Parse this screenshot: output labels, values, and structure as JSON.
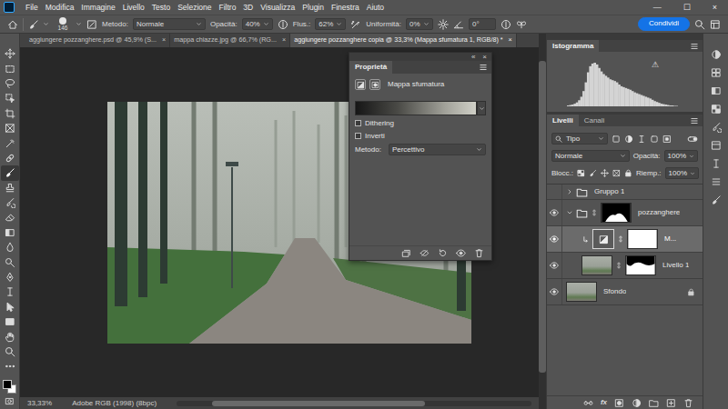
{
  "window": {
    "controls": [
      "—",
      "☐",
      "×"
    ]
  },
  "menu": [
    "File",
    "Modifica",
    "Immagine",
    "Livello",
    "Testo",
    "Selezione",
    "Filtro",
    "3D",
    "Visualizza",
    "Plugin",
    "Finestra",
    "Aiuto"
  ],
  "options_bar": {
    "brush_size": "146",
    "mode_label": "Metodo:",
    "mode": "Normale",
    "opacity_label": "Opacità:",
    "opacity": "40%",
    "flow_label": "Flus.:",
    "flow": "62%",
    "smoothing_label": "Uniformità:",
    "smoothing": "0%",
    "angle": "0°",
    "share": "Condividi"
  },
  "tabs": [
    {
      "label": "aggiungere pozzanghere.psd @ 45,9% (S...",
      "close": "×",
      "selected": false
    },
    {
      "label": "mappa chiazze.jpg @ 66,7% (RG...",
      "close": "×",
      "selected": false
    },
    {
      "label": "aggiungere pozzanghere copia @ 33,3% (Mappa sfumatura 1, RGB/8) *",
      "close": "×",
      "selected": true
    }
  ],
  "toolbar": {
    "tools": [
      {
        "selected": false
      },
      {
        "selected": false
      },
      {
        "selected": false
      },
      {
        "selected": false
      },
      {
        "selected": false
      },
      {
        "selected": false
      },
      {
        "selected": false
      },
      {
        "selected": false
      },
      {
        "selected": true
      },
      {
        "selected": false
      },
      {
        "selected": false
      },
      {
        "selected": false
      },
      {
        "selected": false
      },
      {
        "selected": false
      },
      {
        "selected": false
      },
      {
        "selected": false
      },
      {
        "selected": false
      },
      {
        "selected": false
      },
      {
        "selected": false
      },
      {
        "selected": false
      },
      {
        "selected": false
      },
      {
        "selected": false
      }
    ]
  },
  "properties": {
    "title": "Proprietà",
    "collapse": "«",
    "close": "×",
    "adjustment": "Mappa sfumatura",
    "options": [
      {
        "label": "Dithering",
        "checked": false
      },
      {
        "label": "Inverti",
        "checked": false
      }
    ],
    "method_label": "Metodo:",
    "method": "Percettivo"
  },
  "histogram": {
    "title": "Istogramma",
    "warning": "⚠",
    "values": [
      2,
      3,
      4,
      6,
      9,
      14,
      22,
      35,
      55,
      78,
      92,
      98,
      100,
      96,
      88,
      80,
      74,
      70,
      66,
      62,
      60,
      58,
      55,
      50,
      46,
      44,
      42,
      40,
      38,
      35,
      32,
      30,
      28,
      26,
      24,
      22,
      20,
      18,
      15,
      12,
      10,
      8,
      6,
      5,
      4,
      3,
      2,
      2,
      1,
      1
    ]
  },
  "layers_panel": {
    "tabs": [
      {
        "label": "Livelli",
        "selected": true
      },
      {
        "label": "Canali",
        "selected": false
      }
    ],
    "filter": "Tipo",
    "blend": "Normale",
    "opacity_label": "Opacità:",
    "opacity": "100%",
    "lock_label": "Blocc.:",
    "fill_label": "Riemp.:",
    "fill": "100%",
    "layers": [
      {
        "name": "Gruppo 1",
        "kind": "group",
        "visible": false,
        "expanded": false,
        "selected": false,
        "nested": false,
        "has_mask": false,
        "clipped": false,
        "locked": false
      },
      {
        "name": "pozzanghere",
        "kind": "group",
        "visible": true,
        "expanded": true,
        "selected": false,
        "nested": false,
        "has_mask": true,
        "clipped": false,
        "locked": false
      },
      {
        "name": "M...",
        "kind": "adjustment",
        "visible": true,
        "selected": true,
        "nested": true,
        "has_mask": true,
        "clipped": true,
        "locked": false
      },
      {
        "name": "Livello 1",
        "kind": "pixel",
        "visible": true,
        "selected": false,
        "nested": true,
        "has_mask": true,
        "clipped": false,
        "locked": false
      },
      {
        "name": "Sfondo",
        "kind": "background",
        "visible": true,
        "selected": false,
        "nested": false,
        "has_mask": false,
        "clipped": false,
        "locked": true
      }
    ],
    "footer_fx": "fx"
  },
  "status_bar": {
    "zoom": "33,33%",
    "profile": "Adobe RGB (1998) (8bpc)"
  }
}
